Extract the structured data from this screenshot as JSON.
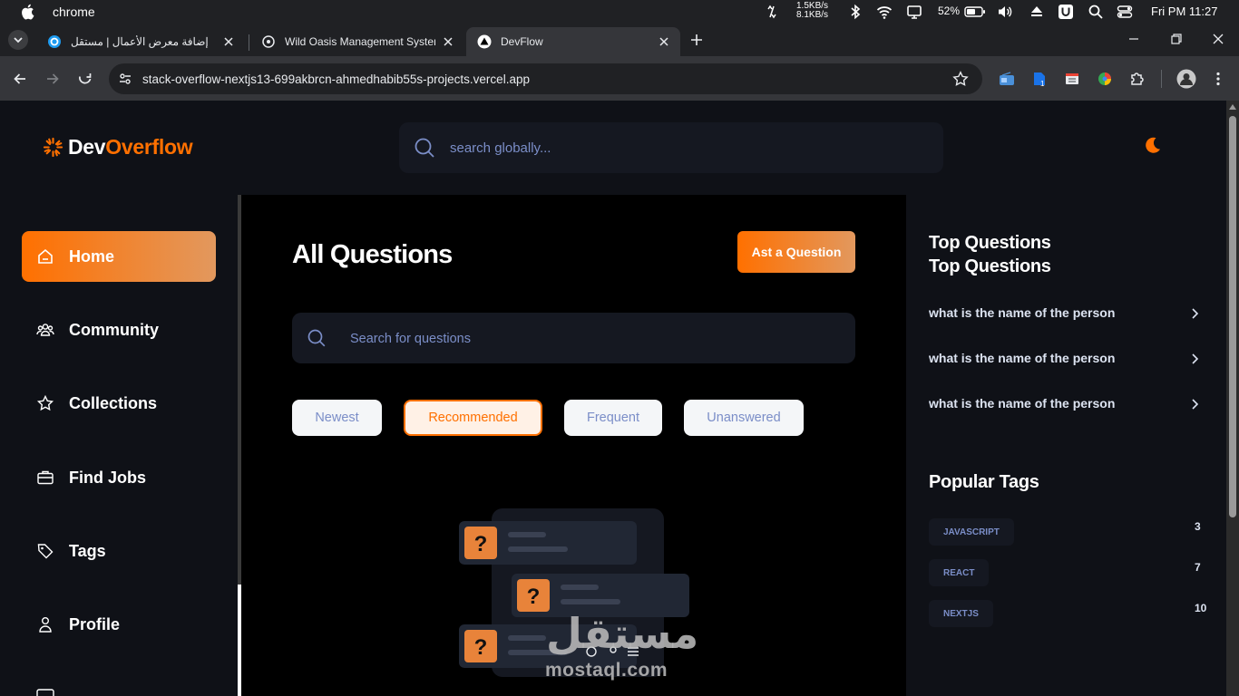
{
  "os": {
    "app_name": "chrome",
    "net_up": "1.5KB/s",
    "net_down": "8.1KB/s",
    "battery": "52%",
    "clock": "Fri PM 11:27"
  },
  "browser": {
    "tabs": [
      {
        "label": "إضافة معرض الأعمال | مستقل",
        "icon": "mostaql-favicon",
        "active": false
      },
      {
        "label": "Wild Oasis Management System",
        "icon": "openai-favicon",
        "active": false
      },
      {
        "label": "DevFlow",
        "icon": "nextjs-favicon",
        "active": true
      }
    ],
    "url": "stack-overflow-nextjs13-699akbrcn-ahmedhabib55s-projects.vercel.app"
  },
  "app": {
    "brand_first": "Dev",
    "brand_second": "Overflow",
    "global_search_placeholder": "search globally...",
    "nav": [
      {
        "label": "Home",
        "icon": "home-icon",
        "active": true
      },
      {
        "label": "Community",
        "icon": "users-icon",
        "active": false
      },
      {
        "label": "Collections",
        "icon": "star-icon",
        "active": false
      },
      {
        "label": "Find Jobs",
        "icon": "suitcase-icon",
        "active": false
      },
      {
        "label": "Tags",
        "icon": "tag-icon",
        "active": false
      },
      {
        "label": "Profile",
        "icon": "user-icon",
        "active": false
      }
    ],
    "page_title": "All Questions",
    "ask_button": "Ast a Question",
    "local_search_placeholder": "Search for questions",
    "filters": [
      {
        "label": "Newest",
        "active": false
      },
      {
        "label": "Recommended",
        "active": true
      },
      {
        "label": "Frequent",
        "active": false
      },
      {
        "label": "Unanswered",
        "active": false
      }
    ],
    "right_sidebar": {
      "top_questions_title_1": "Top Questions",
      "top_questions_title_2": "Top Questions",
      "top_questions": [
        "what is the name of the person",
        "what is the name of the person",
        "what is the name of the person"
      ],
      "popular_tags_title": "Popular Tags",
      "tags": [
        {
          "name": "JAVASCRIPT",
          "count": "3"
        },
        {
          "name": "REACT",
          "count": "7"
        },
        {
          "name": "NEXTJS",
          "count": "10"
        }
      ]
    }
  },
  "watermark": {
    "arabic": "مستقل",
    "latin": "mostaql.com"
  },
  "colors": {
    "accent": "#ff7000",
    "accent_end": "#e2985e",
    "panel": "#0f1117",
    "input_bg": "#151821",
    "muted_text": "#7b8ec8"
  }
}
